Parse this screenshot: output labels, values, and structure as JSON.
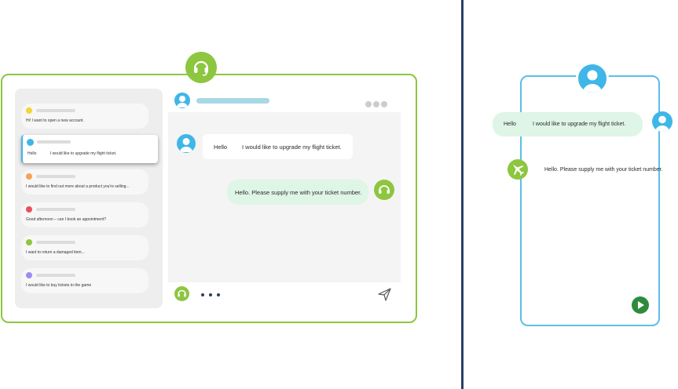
{
  "inbox": {
    "conversations": [
      {
        "preview": "Hi! I want to open a new account.",
        "dot_color": "#f5d33a"
      },
      {
        "preview_hello": "Hello",
        "preview": "I would like to upgrade my flight ticket.",
        "dot_color": "#3fb6e8",
        "active": true
      },
      {
        "preview": "I would like to find out more about a product you're selling...",
        "dot_color": "#f5a35c"
      },
      {
        "preview": "Good afternoon – can I book an appointment?",
        "dot_color": "#e8505b"
      },
      {
        "preview": "I want to return a damaged item...",
        "dot_color": "#8dc63f"
      },
      {
        "preview": "I would like to buy tickets to the game",
        "dot_color": "#9b8cf0"
      }
    ]
  },
  "chat": {
    "user_message": {
      "greeting": "Hello",
      "text": "I would like to upgrade my flight ticket."
    },
    "agent_message": {
      "text": "Hello. Please supply me with your ticket number."
    }
  },
  "mobile": {
    "user_message": {
      "greeting": "Hello",
      "text": "I would like to upgrade my flight ticket."
    },
    "agent_message": {
      "text": "Hello. Please supply me with your ticket number."
    }
  },
  "colors": {
    "accent_green": "#8dc63f",
    "accent_blue": "#3fb6e8",
    "divider": "#2c3e66",
    "send_green": "#2e8b3e"
  },
  "icons": [
    "headset-icon",
    "user-avatar-icon",
    "more-dots-icon",
    "send-icon",
    "airplane-icon",
    "play-send-icon",
    "typing-dots-icon"
  ]
}
